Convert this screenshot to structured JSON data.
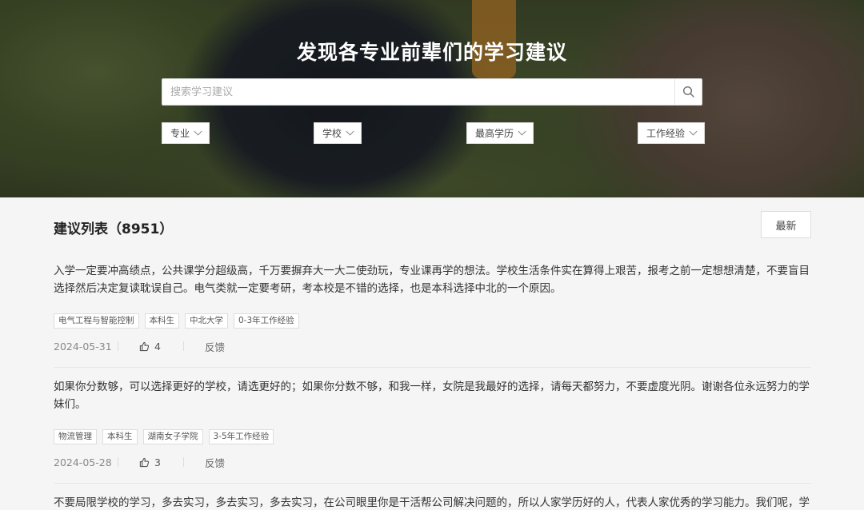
{
  "hero": {
    "title": "发现各专业前辈们的学习建议",
    "search_placeholder": "搜索学习建议",
    "filters": [
      "专业",
      "学校",
      "最高学历",
      "工作经验"
    ]
  },
  "list": {
    "title": "建议列表（8951）",
    "sort_label": "最新"
  },
  "items": [
    {
      "text": "入学一定要冲高绩点，公共课学分超级高，千万要摒弃大一大二使劲玩，专业课再学的想法。学校生活条件实在算得上艰苦，报考之前一定想想清楚，不要盲目选择然后决定复读耽误自己。电气类就一定要考研，考本校是不错的选择，也是本科选择中北的一个原因。",
      "tags": [
        "电气工程与智能控制",
        "本科生",
        "中北大学",
        "0-3年工作经验"
      ],
      "date": "2024-05-31",
      "likes": "4",
      "feedback": "反馈"
    },
    {
      "text": "如果你分数够，可以选择更好的学校，请选更好的；如果你分数不够，和我一样，女院是我最好的选择，请每天都努力，不要虚度光阴。谢谢各位永远努力的学妹们。",
      "tags": [
        "物流管理",
        "本科生",
        "湖南女子学院",
        "3-5年工作经验"
      ],
      "date": "2024-05-28",
      "likes": "3",
      "feedback": "反馈"
    },
    {
      "text": "不要局限学校的学习，多去实习，多去实习，多去实习，在公司眼里你是干活帮公司解决问题的，所以人家学历好的人，代表人家优秀的学习能力。我们呢，学"
    }
  ],
  "icons": {
    "search": "search-icon",
    "like": "thumbs-up-icon",
    "chevron": "chevron-down-icon"
  }
}
